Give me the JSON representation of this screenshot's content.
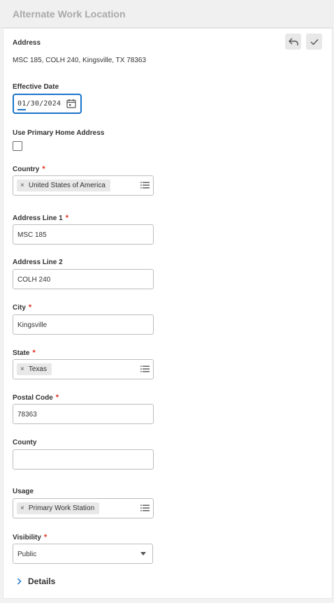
{
  "header": {
    "title": "Alternate Work Location"
  },
  "toolbar": {
    "back_icon": "undo-arrow-icon",
    "confirm_icon": "check-icon"
  },
  "address": {
    "label": "Address",
    "value": "MSC 185, COLH 240, Kingsville, TX 78363"
  },
  "effective_date": {
    "label": "Effective Date",
    "value": "01/30/2024"
  },
  "use_primary_home": {
    "label": "Use Primary Home Address",
    "checked": false
  },
  "country": {
    "label": "Country",
    "required_mark": "*",
    "selected": "United States of America",
    "remove": "×"
  },
  "address_line_1": {
    "label": "Address Line 1",
    "required_mark": "*",
    "value": "MSC 185"
  },
  "address_line_2": {
    "label": "Address Line 2",
    "value": "COLH 240"
  },
  "city": {
    "label": "City",
    "required_mark": "*",
    "value": "Kingsville"
  },
  "state": {
    "label": "State",
    "required_mark": "*",
    "selected": "Texas",
    "remove": "×"
  },
  "postal_code": {
    "label": "Postal Code",
    "required_mark": "*",
    "value": "78363"
  },
  "county": {
    "label": "County",
    "value": ""
  },
  "usage": {
    "label": "Usage",
    "selected": "Primary Work Station",
    "remove": "×"
  },
  "visibility": {
    "label": "Visibility",
    "required_mark": "*",
    "value": "Public"
  },
  "details": {
    "label": "Details"
  }
}
